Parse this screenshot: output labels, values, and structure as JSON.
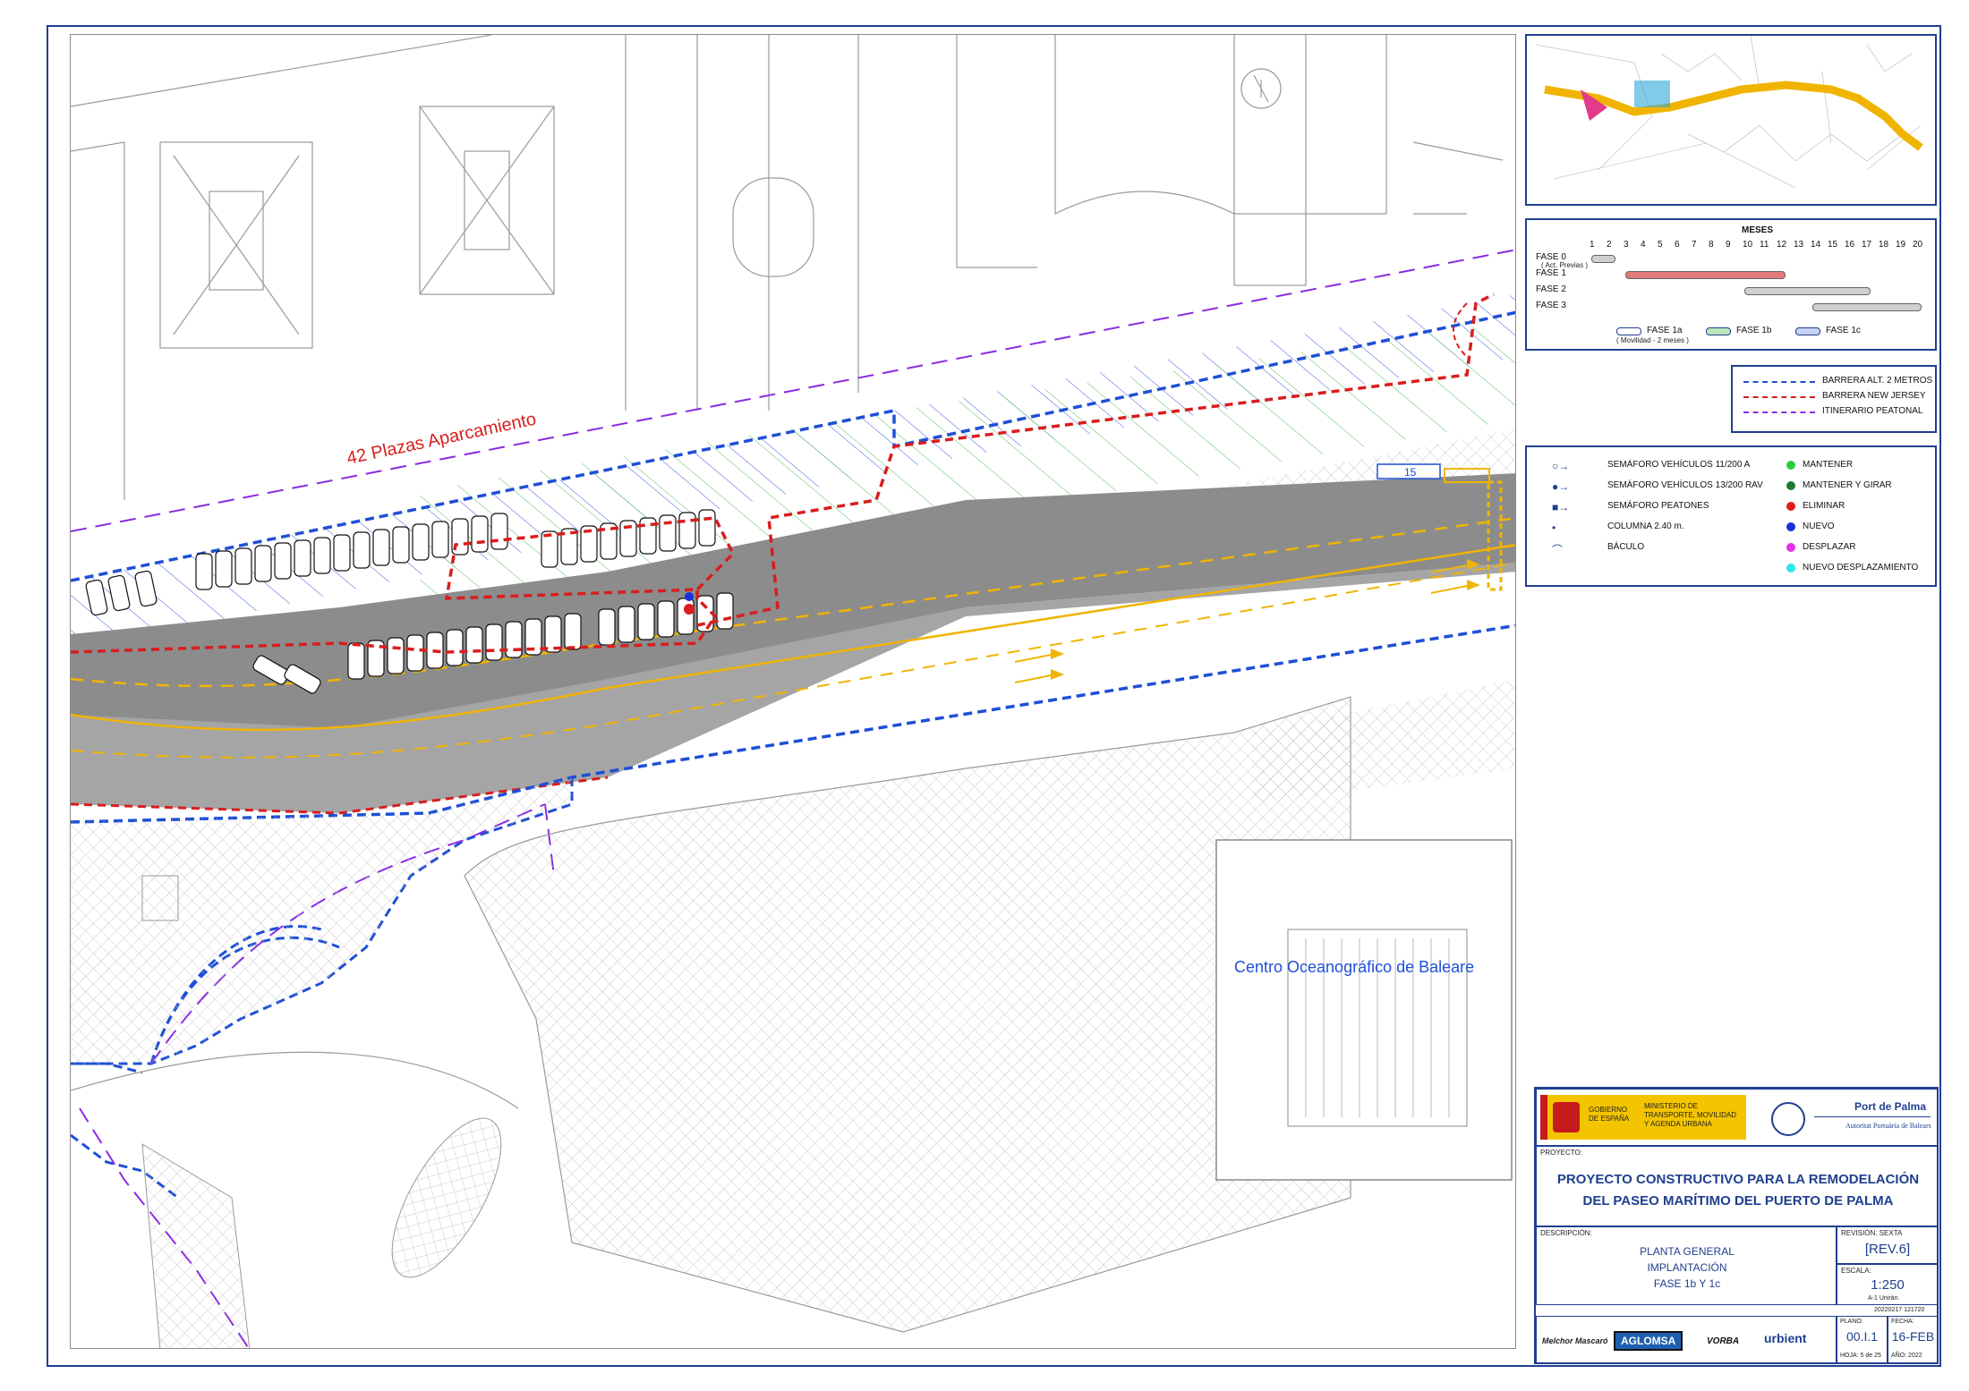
{
  "map": {
    "label_parking": "42 Plazas Aparcamiento",
    "label_center": "Centro Oceanográfico de Baleare",
    "marker_15": "15",
    "colors": {
      "road": "#8c8c8c",
      "lane": "#f0b400",
      "blue_barrier": "#1e4fd6",
      "red_barrier": "#d81e1e",
      "purple_route": "#8a2be2",
      "green_hatch": "#5bc15b",
      "hatch_blue": "#3b5bdb"
    }
  },
  "schedule": {
    "title": "MESES",
    "months": [
      "1",
      "2",
      "3",
      "4",
      "5",
      "6",
      "7",
      "8",
      "9",
      "10",
      "11",
      "12",
      "13",
      "14",
      "15",
      "16",
      "17",
      "18",
      "19",
      "20"
    ],
    "phases": [
      {
        "label": "FASE 0",
        "sub": "( Act. Previas )",
        "start": 1,
        "end": 2
      },
      {
        "label": "FASE 1",
        "sub": "",
        "start": 3,
        "end": 12
      },
      {
        "label": "FASE 2",
        "sub": "",
        "start": 10,
        "end": 17
      },
      {
        "label": "FASE 3",
        "sub": "",
        "start": 14,
        "end": 20
      }
    ],
    "legend": [
      {
        "label": "FASE 1a",
        "sub": "( Movilidad - 2 meses )"
      },
      {
        "label": "FASE 1b",
        "sub": ""
      },
      {
        "label": "FASE 1c",
        "sub": ""
      }
    ]
  },
  "line_legend": [
    {
      "label": "BARRERA ALT. 2 METROS",
      "color": "#1e4fd6"
    },
    {
      "label": "BARRERA NEW JERSEY",
      "color": "#d81e1e"
    },
    {
      "label": "ITINERARIO  PEATONAL",
      "color": "#8a2be2"
    }
  ],
  "symbol_legend": {
    "symbols": [
      {
        "label": "SEMÁFORO VEHÍCULOS 11/200 A",
        "icon": "traffic-light-open-icon"
      },
      {
        "label": "SEMÁFORO VEHÍCULOS 13/200 RAV",
        "icon": "traffic-light-filled-icon"
      },
      {
        "label": "SEMÁFORO PEATONES",
        "icon": "pedestrian-light-icon"
      },
      {
        "label": "COLUMNA 2.40 m.",
        "icon": "column-icon"
      },
      {
        "label": "BÁCULO",
        "icon": "lamp-post-icon"
      }
    ],
    "states": [
      {
        "label": "MANTENER",
        "color": "#2ecc40"
      },
      {
        "label": "MANTENER Y GIRAR",
        "color": "#1e7a32"
      },
      {
        "label": "ELIMINAR",
        "color": "#e01b1b"
      },
      {
        "label": "NUEVO",
        "color": "#1a2fd8"
      },
      {
        "label": "DESPLAZAR",
        "color": "#e62ee6"
      },
      {
        "label": "NUEVO DESPLAZAMIENTO",
        "color": "#2fe6ef"
      }
    ]
  },
  "title_block": {
    "gov_line1": "GOBIERNO",
    "gov_line2": "DE ESPAÑA",
    "ministry": "MINISTERIO DE TRANSPORTE, MOVILIDAD Y AGENDA URBANA",
    "port_name": "Port de Palma",
    "port_sub": "Autoritat Portuària de Balears",
    "project_label": "PROYECTO:",
    "project_title_1": "PROYECTO CONSTRUCTIVO PARA LA REMODELACIÓN",
    "project_title_2": "DEL PASEO MARÍTIMO DEL PUERTO DE PALMA",
    "desc_label": "DESCRIPCIÓN:",
    "desc_1": "PLANTA GENERAL",
    "desc_2": "IMPLANTACIÓN",
    "desc_3": "FASE 1b Y 1c",
    "rev_label": "REVISIÓN:",
    "rev_word": "SEXTA",
    "rev_value": "[REV.6]",
    "scale_label": "ESCALA:",
    "scale_value": "1:250",
    "scale_note": "A-1 Unirán.",
    "file_ref": "20220217 121720",
    "plano_label": "PLANO:",
    "plano_value": "00.I.1",
    "hoja": "HOJA: 5 de 25",
    "fecha_label": "FECHA:",
    "fecha_value": "16-FEB",
    "anio": "AÑO: 2022",
    "companies": [
      "Melchor Mascaró",
      "AGLOMSA",
      "VORBA",
      "urbient"
    ]
  }
}
